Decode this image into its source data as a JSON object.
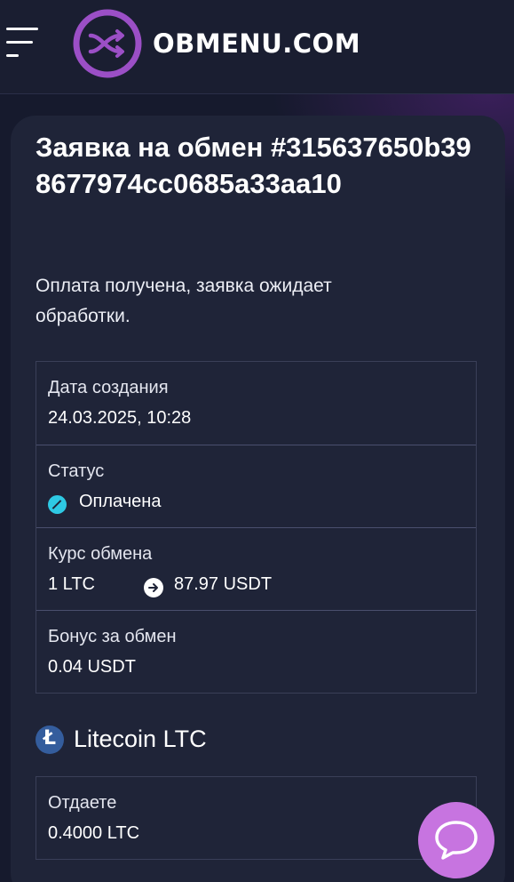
{
  "header": {
    "menu_icon": "hamburger-menu-icon",
    "logo_icon": "exchange-arrows-logo-icon",
    "logo_text": "OBMENU.COM",
    "accent_color": "#9b4fc6"
  },
  "order": {
    "title": "Заявка на обмен #315637650b398677974cc0685a33aa10",
    "status_message": "Оплата получена, заявка ожидает обработки."
  },
  "details": {
    "created_label": "Дата создания",
    "created_value": "24.03.2025, 10:28",
    "status_label": "Статус",
    "status_value": "Оплачена",
    "status_icon": "paid-status-icon",
    "status_color": "#2ec9e4",
    "rate_label": "Курс обмена",
    "rate_from": "1 LTC",
    "rate_arrow_icon": "arrow-right-icon",
    "rate_to": "87.97 USDT",
    "bonus_label": "Бонус за обмен",
    "bonus_value": "0.04 USDT"
  },
  "give": {
    "coin_icon": "litecoin-icon",
    "coin_icon_glyph": "Ł",
    "coin_name": "Litecoin LTC",
    "label": "Отдаете",
    "amount": "0.4000 LTC"
  },
  "chat": {
    "icon": "chat-bubble-icon",
    "color": "#c774e0"
  }
}
